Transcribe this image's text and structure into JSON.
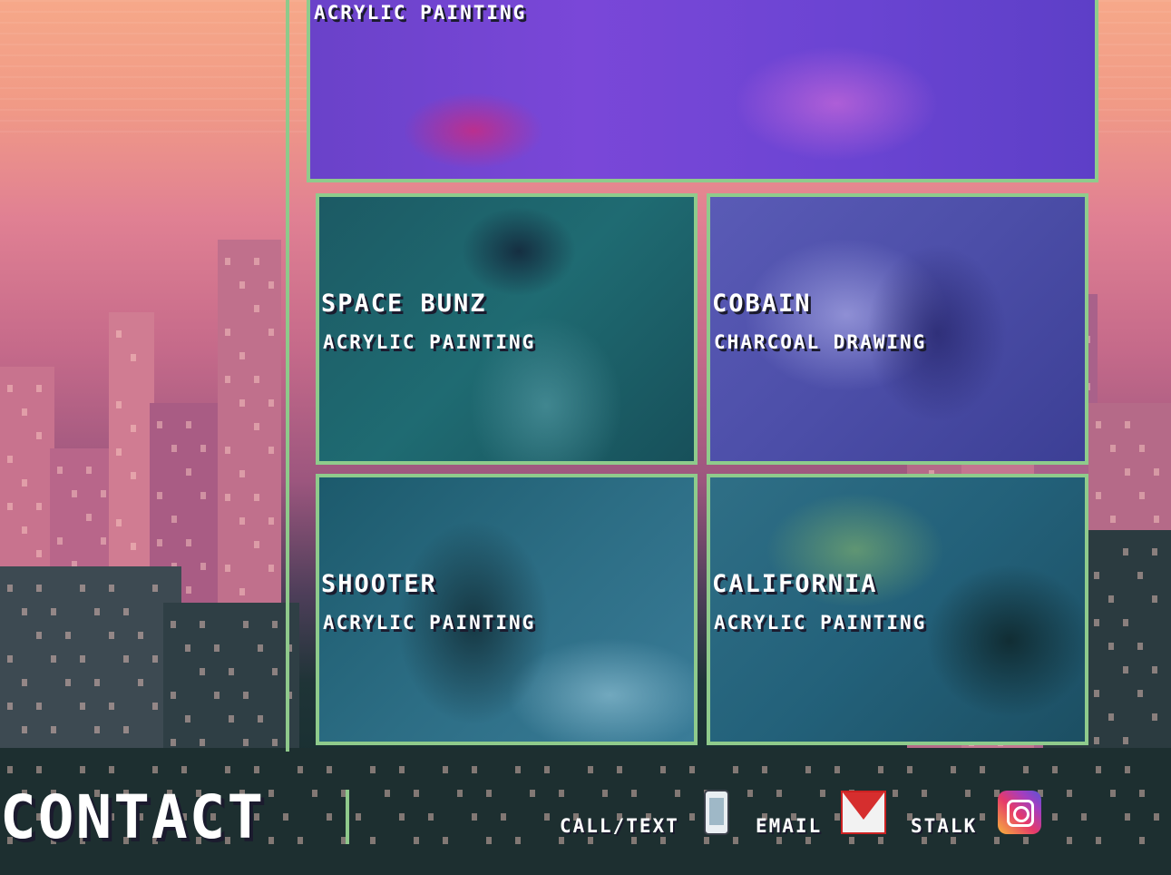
{
  "gallery": {
    "top_card": {
      "medium": "ACRYLIC PAINTING"
    },
    "cards": [
      {
        "title": "SPACE BUNZ",
        "medium": "ACRYLIC PAINTING"
      },
      {
        "title": "COBAIN",
        "medium": "CHARCOAL DRAWING"
      },
      {
        "title": "SHOOTER",
        "medium": "ACRYLIC PAINTING"
      },
      {
        "title": "CALIFORNIA",
        "medium": "ACRYLIC PAINTING"
      }
    ]
  },
  "contact": {
    "heading": "CONTACT",
    "links": [
      {
        "label": "CALL/TEXT",
        "icon": "phone-icon"
      },
      {
        "label": "EMAIL",
        "icon": "gmail-icon"
      },
      {
        "label": "STALK",
        "icon": "instagram-icon"
      }
    ]
  },
  "colors": {
    "accent_green": "#8fc98b"
  }
}
